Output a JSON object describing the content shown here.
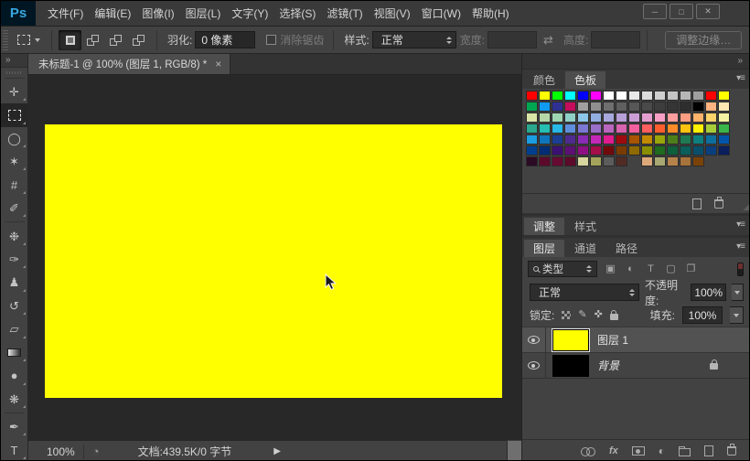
{
  "menu_bar": {
    "logo": "Ps",
    "items": [
      "文件(F)",
      "编辑(E)",
      "图像(I)",
      "图层(L)",
      "文字(Y)",
      "选择(S)",
      "滤镜(T)",
      "视图(V)",
      "窗口(W)",
      "帮助(H)"
    ]
  },
  "window_controls": {
    "minimize": "─",
    "maximize": "□",
    "close": "✕"
  },
  "options_bar": {
    "feather_label": "羽化:",
    "feather_value": "0 像素",
    "antialias_label": "消除锯齿",
    "style_label": "样式:",
    "style_value": "正常",
    "width_label": "宽度:",
    "width_value": "",
    "swap_glyph": "⇄",
    "height_label": "高度:",
    "height_value": "",
    "refine_edge_label": "调整边缘…"
  },
  "toolbar": {
    "collapse_glyph": "»",
    "tools": [
      {
        "name": "move-tool",
        "glyph": "✛"
      },
      {
        "name": "rectangular-marquee-tool",
        "type": "marquee",
        "active": true
      },
      {
        "name": "lasso-tool",
        "glyph": "◯"
      },
      {
        "name": "magic-wand-tool",
        "glyph": "✶"
      },
      {
        "name": "crop-tool",
        "glyph": "#"
      },
      {
        "name": "eyedropper-tool",
        "glyph": "✐"
      },
      {
        "name": "spot-healing-brush-tool",
        "glyph": "❉",
        "sep_before": true
      },
      {
        "name": "brush-tool",
        "glyph": "✑"
      },
      {
        "name": "clone-stamp-tool",
        "glyph": "♟"
      },
      {
        "name": "history-brush-tool",
        "glyph": "↺"
      },
      {
        "name": "eraser-tool",
        "glyph": "▱"
      },
      {
        "name": "gradient-tool",
        "type": "gradient"
      },
      {
        "name": "blur-tool",
        "glyph": "●"
      },
      {
        "name": "dodge-tool",
        "glyph": "❋"
      },
      {
        "name": "pen-tool",
        "glyph": "✒",
        "sep_before": true
      },
      {
        "name": "type-tool",
        "glyph": "T"
      }
    ]
  },
  "document": {
    "tab_title": "未标题-1 @ 100% (图层 1, RGB/8) *",
    "close_glyph": "×",
    "canvas_color": "#ffff00"
  },
  "dock": {
    "collapse_glyph": "»",
    "panel_menu_glyph": "▾≡",
    "corner_grip_glyph": "◢"
  },
  "swatches_panel": {
    "tabs": [
      "颜色",
      "色板"
    ],
    "active_index": 1,
    "grid": [
      [
        "#ff0000",
        "#ffff00",
        "#00ff00",
        "#00ffff",
        "#0000ff",
        "#ff00ff",
        "#ffffff",
        "#ffffff",
        "#e8e8e8",
        "#dcdcdc",
        "#cfcfcf",
        "#c3c3c3",
        "#b7b7b7",
        "#9f9f9f",
        "#ff0000",
        "#ffff00"
      ],
      [
        "#00a651",
        "#0f9bf2",
        "#2e3192",
        "#c40d5d",
        "#a0a0a0",
        "#8f8f8f",
        "#6f6f6f",
        "#5f5f5f",
        "#575757",
        "#4a4a4a",
        "#3d3d3d",
        "#353535",
        "#2e2e2e",
        "#000000",
        "#ffb380",
        "#ffe8b3"
      ],
      [
        "#d9e4a7",
        "#b5d7a8",
        "#9fd6b2",
        "#8fd0c7",
        "#8cc6e8",
        "#92aee0",
        "#a7a9dc",
        "#b79fd8",
        "#cc9ed6",
        "#e49fd0",
        "#f79ec5",
        "#ff9e9e",
        "#ff9e82",
        "#ffb36b",
        "#ffd36b",
        "#f5f3a1"
      ],
      [
        "#29a88e",
        "#26bdb2",
        "#28b8e8",
        "#5f8fdc",
        "#7a78d2",
        "#9a6fc8",
        "#b966be",
        "#d863ae",
        "#f2609e",
        "#ff5f5f",
        "#ff5f2e",
        "#ff8c29",
        "#ffc20e",
        "#fff200",
        "#a6ce39",
        "#39b54a"
      ],
      [
        "#1b9de2",
        "#0f75bc",
        "#1c3f94",
        "#4f2b8f",
        "#8a2bb5",
        "#c428b8",
        "#e01c8f",
        "#9e0b0f",
        "#a85400",
        "#c18a00",
        "#9aa50a",
        "#4c7f19",
        "#1e7a52",
        "#0e7f7f",
        "#0c6f9e",
        "#0055aa"
      ],
      [
        "#003f8f",
        "#002d73",
        "#3b1073",
        "#5c1073",
        "#8f0f85",
        "#a50d49",
        "#700909",
        "#7a3b00",
        "#8f6a00",
        "#8a8f00",
        "#1f6b1f",
        "#0e5f3c",
        "#0a5f5a",
        "#094f6b",
        "#0a3f7f",
        "#0a1f5c"
      ],
      [
        "#2b0a24",
        "#5c0a2b",
        "#660a33",
        "#5c0a29",
        "#d6d69e",
        "#a3a35c",
        "#5c5c5c",
        "#4f2b24",
        null,
        "#dca87a",
        "#a8a873",
        "#b5834a",
        "#a8733b",
        "#7a4208",
        null,
        null
      ]
    ],
    "footer_icons": [
      {
        "name": "new-swatch-icon",
        "css": "i-page"
      },
      {
        "name": "delete-swatch-icon",
        "css": "i-trash"
      }
    ]
  },
  "adjustments_panel": {
    "tabs": [
      "调整",
      "样式"
    ],
    "active_index": 0
  },
  "layers_panel": {
    "tabs": [
      "图层",
      "通道",
      "路径"
    ],
    "active_index": 0,
    "filter_label": "类型",
    "filter_icons": [
      {
        "name": "filter-pixel-layers-icon",
        "glyph": "▣"
      },
      {
        "name": "filter-adjustment-layers-icon",
        "glyph": "◐"
      },
      {
        "name": "filter-type-layers-icon",
        "glyph": "T"
      },
      {
        "name": "filter-shape-layers-icon",
        "glyph": "▢"
      },
      {
        "name": "filter-smart-objects-icon",
        "glyph": "❐"
      }
    ],
    "blend_mode": "正常",
    "opacity_label": "不透明度:",
    "opacity_value": "100%",
    "lock_label": "锁定:",
    "lock_icons": [
      {
        "name": "lock-transparency-icon",
        "css": "i-checker"
      },
      {
        "name": "lock-paint-icon",
        "glyph": "✎"
      },
      {
        "name": "lock-position-icon",
        "glyph": "✜"
      },
      {
        "name": "lock-all-icon",
        "css": "i-lock"
      }
    ],
    "fill_label": "填充:",
    "fill_value": "100%",
    "layers": [
      {
        "name": "图层 1",
        "thumb_color": "#ffff00",
        "selected": true,
        "locked": false,
        "visible": true,
        "italic": false
      },
      {
        "name": "背景",
        "thumb_color": "#000000",
        "selected": false,
        "locked": true,
        "visible": true,
        "italic": true
      }
    ],
    "footer_icons": [
      {
        "name": "link-layers-icon",
        "css": "i-chain"
      },
      {
        "name": "layer-style-icon",
        "text": "fx"
      },
      {
        "name": "add-layer-mask-icon",
        "css": "i-mask"
      },
      {
        "name": "new-adjustment-layer-icon",
        "glyph": "◐"
      },
      {
        "name": "new-group-icon",
        "css": "i-folder"
      },
      {
        "name": "new-layer-icon",
        "css": "i-page"
      },
      {
        "name": "delete-layer-icon",
        "css": "i-trash"
      }
    ]
  },
  "status_bar": {
    "zoom": "100%",
    "status_icon_glyph": "◔",
    "doc_info": "文档:439.5K/0 字节",
    "expand_glyph": "▶"
  }
}
